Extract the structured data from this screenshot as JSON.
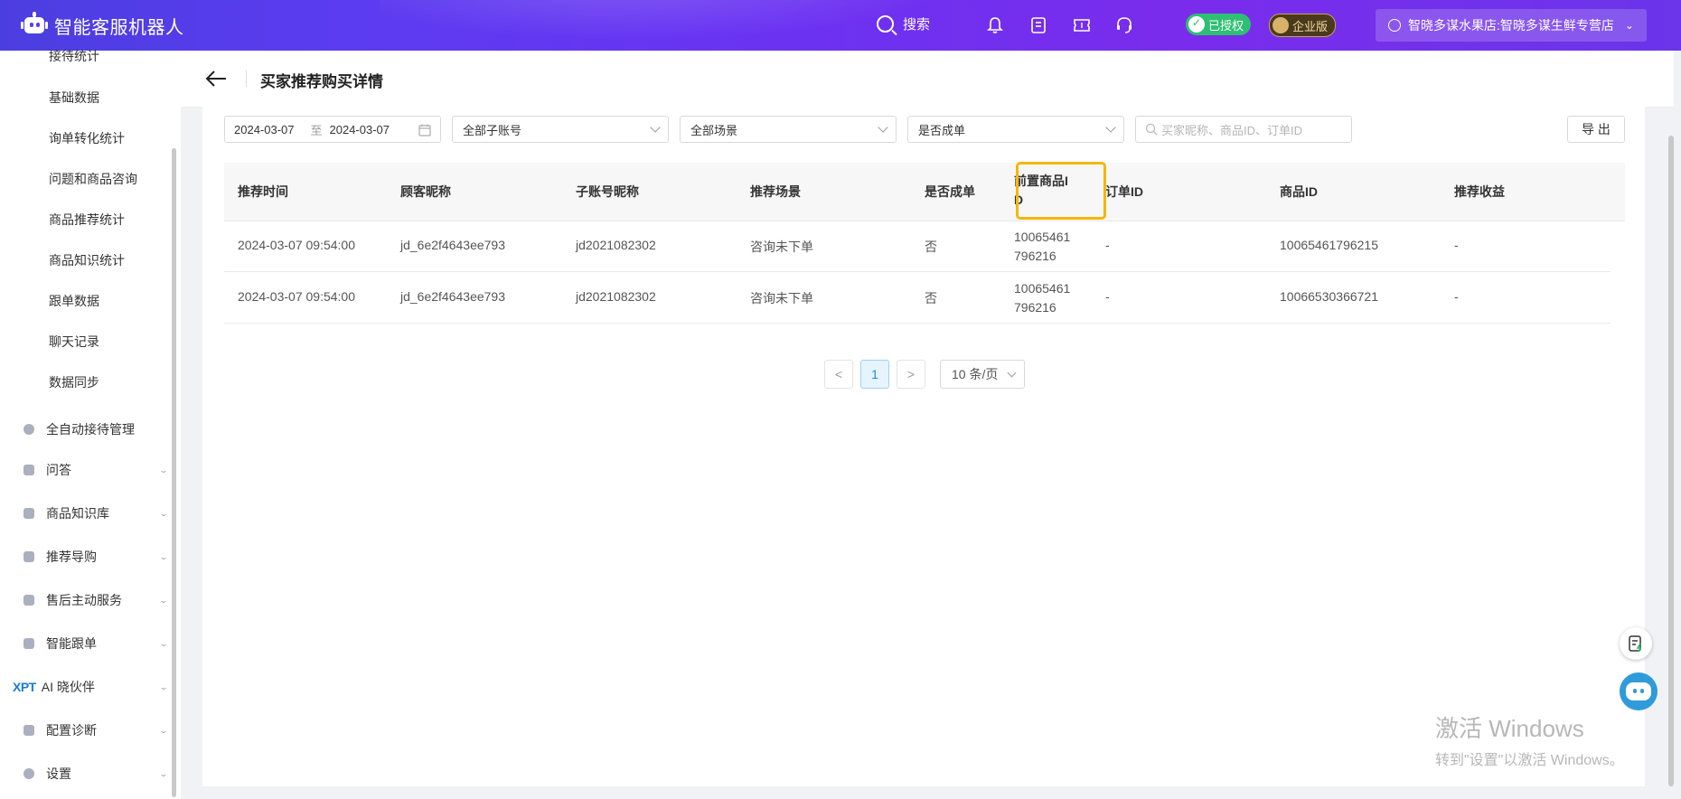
{
  "app": {
    "title": "智能客服机器人"
  },
  "header": {
    "search_label": "搜索",
    "auth_badge": "已授权",
    "edition_badge": "企业版",
    "store_name": "智晓多谋水果店:智晓多谋生鲜专营店"
  },
  "sidebar": {
    "sub_items": [
      "接待统计",
      "基础数据",
      "询单转化统计",
      "问题和商品咨询",
      "商品推荐统计",
      "商品知识统计",
      "跟单数据",
      "聊天记录",
      "数据同步"
    ],
    "main_items": [
      "全自动接待管理",
      "问答",
      "商品知识库",
      "推荐导购",
      "售后主动服务",
      "智能跟单",
      "AI 晓伙伴",
      "配置诊断",
      "设置"
    ],
    "xpt_label": "XPT"
  },
  "page": {
    "title": "买家推荐购买详情"
  },
  "filters": {
    "date_start": "2024-03-07",
    "date_sep": "至",
    "date_end": "2024-03-07",
    "account_select": "全部子账号",
    "scene_select": "全部场景",
    "deal_select": "是否成单",
    "search_placeholder": "买家昵称、商品ID、订单ID",
    "export_label": "导 出"
  },
  "table": {
    "columns": [
      "推荐时间",
      "顾客昵称",
      "子账号昵称",
      "推荐场景",
      "是否成单",
      "前置商品ID",
      "订单ID",
      "商品ID",
      "推荐收益"
    ],
    "rows": [
      [
        "2024-03-07 09:54:00",
        "jd_6e2f4643ee793",
        "jd2021082302",
        "咨询未下单",
        "否",
        "10065461796216",
        "-",
        "10065461796215",
        "-"
      ],
      [
        "2024-03-07 09:54:00",
        "jd_6e2f4643ee793",
        "jd2021082302",
        "咨询未下单",
        "否",
        "10065461796216",
        "-",
        "10066530366721",
        "-"
      ]
    ]
  },
  "pagination": {
    "current_page": "1",
    "page_size": "10 条/页",
    "prev": "<",
    "next": ">"
  },
  "watermark": {
    "line1": "激活 Windows",
    "line2": "转到\"设置\"以激活 Windows。"
  },
  "colors": {
    "header_start": "#4b3ee0",
    "header_end": "#7a2cec",
    "highlight": "#f5b70a",
    "active_page": "#1a8ce6"
  }
}
